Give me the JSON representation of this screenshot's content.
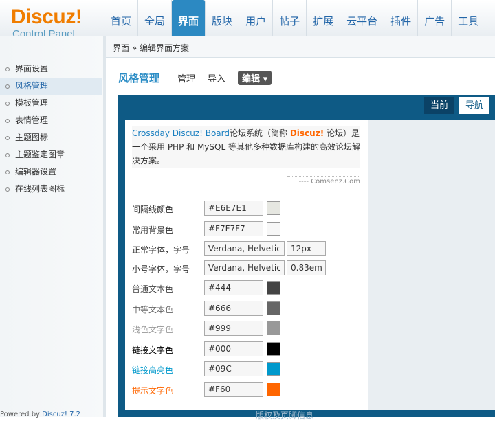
{
  "logo": {
    "brand": "Discuz!",
    "subtitle": "Control Panel"
  },
  "nav": [
    "首页",
    "全局",
    "界面",
    "版块",
    "用户",
    "帖子",
    "扩展",
    "云平台",
    "插件",
    "广告",
    "工具"
  ],
  "sidebar": {
    "items": [
      "界面设置",
      "风格管理",
      "模板管理",
      "表情管理",
      "主题图标",
      "主题鉴定图章",
      "编辑器设置",
      "在线列表图标"
    ],
    "footer_prefix": "Powered by ",
    "footer_link": "Discuz! 7.2"
  },
  "breadcrumb": "界面 » 编辑界面方案",
  "main": {
    "title": "风格管理",
    "tabs": [
      "管理",
      "导入",
      "编辑 ▾"
    ]
  },
  "preview": {
    "tab_current": "当前",
    "tab_nav": "导航",
    "intro": {
      "brand": "Crossday Discuz! Board",
      "text1": "论坛系统（简称 ",
      "brand2": "Discuz!",
      "text2": " 论坛）是一个采用 PHP 和 MySQL 等其他多种数据库构建的高效论坛解决方案。",
      "source": "---- Comsenz.Com"
    },
    "rows": [
      {
        "label": "间隔线颜色",
        "value": "#E6E7E1",
        "swatch": "#E6E7E1",
        "label_color": "#333"
      },
      {
        "label": "常用背景色",
        "value": "#F7F7F7",
        "swatch": "#F7F7F7",
        "label_color": "#333"
      },
      {
        "label": "正常字体，字号",
        "value": "Verdana, Helvetica",
        "size": "12px",
        "label_color": "#333"
      },
      {
        "label": "小号字体，字号",
        "value": "Verdana, Helvetica",
        "size": "0.83em",
        "label_color": "#333"
      },
      {
        "label": "普通文本色",
        "value": "#444",
        "swatch": "#444444",
        "label_color": "#444"
      },
      {
        "label": "中等文本色",
        "value": "#666",
        "swatch": "#666666",
        "label_color": "#666"
      },
      {
        "label": "浅色文字色",
        "value": "#999",
        "swatch": "#999999",
        "label_color": "#999"
      },
      {
        "label": "链接文字色",
        "value": "#000",
        "swatch": "#000000",
        "label_color": "#000"
      },
      {
        "label": "链接高亮色",
        "value": "#09C",
        "swatch": "#0099CC",
        "label_color": "#0099CC"
      },
      {
        "label": "提示文字色",
        "value": "#F60",
        "swatch": "#FF6600",
        "label_color": "#FF6600"
      }
    ],
    "footer": "版权及页脚信息"
  }
}
